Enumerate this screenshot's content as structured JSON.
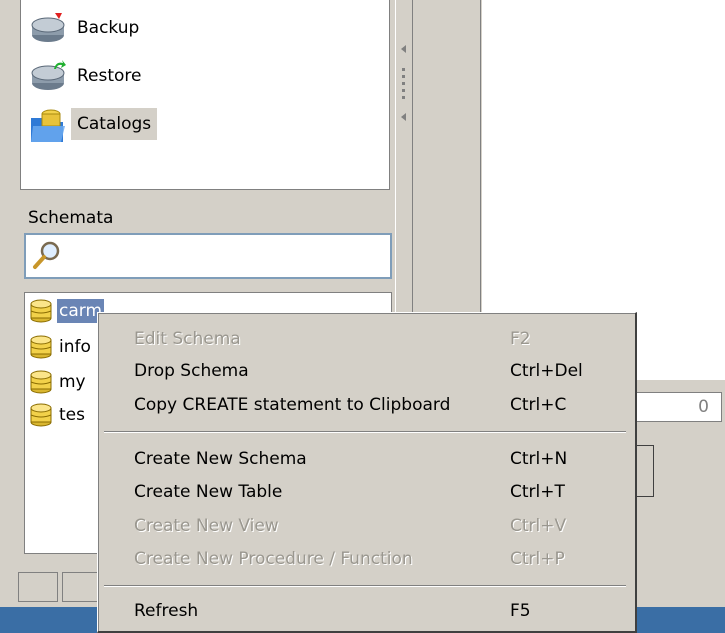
{
  "nav": {
    "items": [
      {
        "label": "Backup",
        "icon": "backup-drive-icon"
      },
      {
        "label": "Restore",
        "icon": "restore-drive-icon"
      },
      {
        "label": "Catalogs",
        "icon": "catalogs-folder-icon",
        "selected": true
      }
    ]
  },
  "schemata": {
    "label": "Schemata",
    "search_placeholder": "",
    "items": [
      {
        "label": "carm",
        "selected": true
      },
      {
        "label": "info"
      },
      {
        "label": "my"
      },
      {
        "label": "tes"
      }
    ]
  },
  "right_panel": {
    "field_value": "0"
  },
  "context_menu": {
    "items": [
      {
        "label": "Edit Schema",
        "shortcut": "F2",
        "enabled": false
      },
      {
        "label": "Drop Schema",
        "shortcut": "Ctrl+Del",
        "enabled": true
      },
      {
        "label": "Copy CREATE statement to Clipboard",
        "shortcut": "Ctrl+C",
        "enabled": true
      },
      {
        "separator": true
      },
      {
        "label": "Create New Schema",
        "shortcut": "Ctrl+N",
        "enabled": true
      },
      {
        "label": "Create New Table",
        "shortcut": "Ctrl+T",
        "enabled": true
      },
      {
        "label": "Create New View",
        "shortcut": "Ctrl+V",
        "enabled": false
      },
      {
        "label": "Create New Procedure / Function",
        "shortcut": "Ctrl+P",
        "enabled": false
      },
      {
        "separator": true
      },
      {
        "label": "Refresh",
        "shortcut": "F5",
        "enabled": true
      }
    ]
  },
  "colors": {
    "window_bg": "#d4d0c8",
    "selection": "#6a85b5",
    "disabled_text": "#9a978f"
  }
}
